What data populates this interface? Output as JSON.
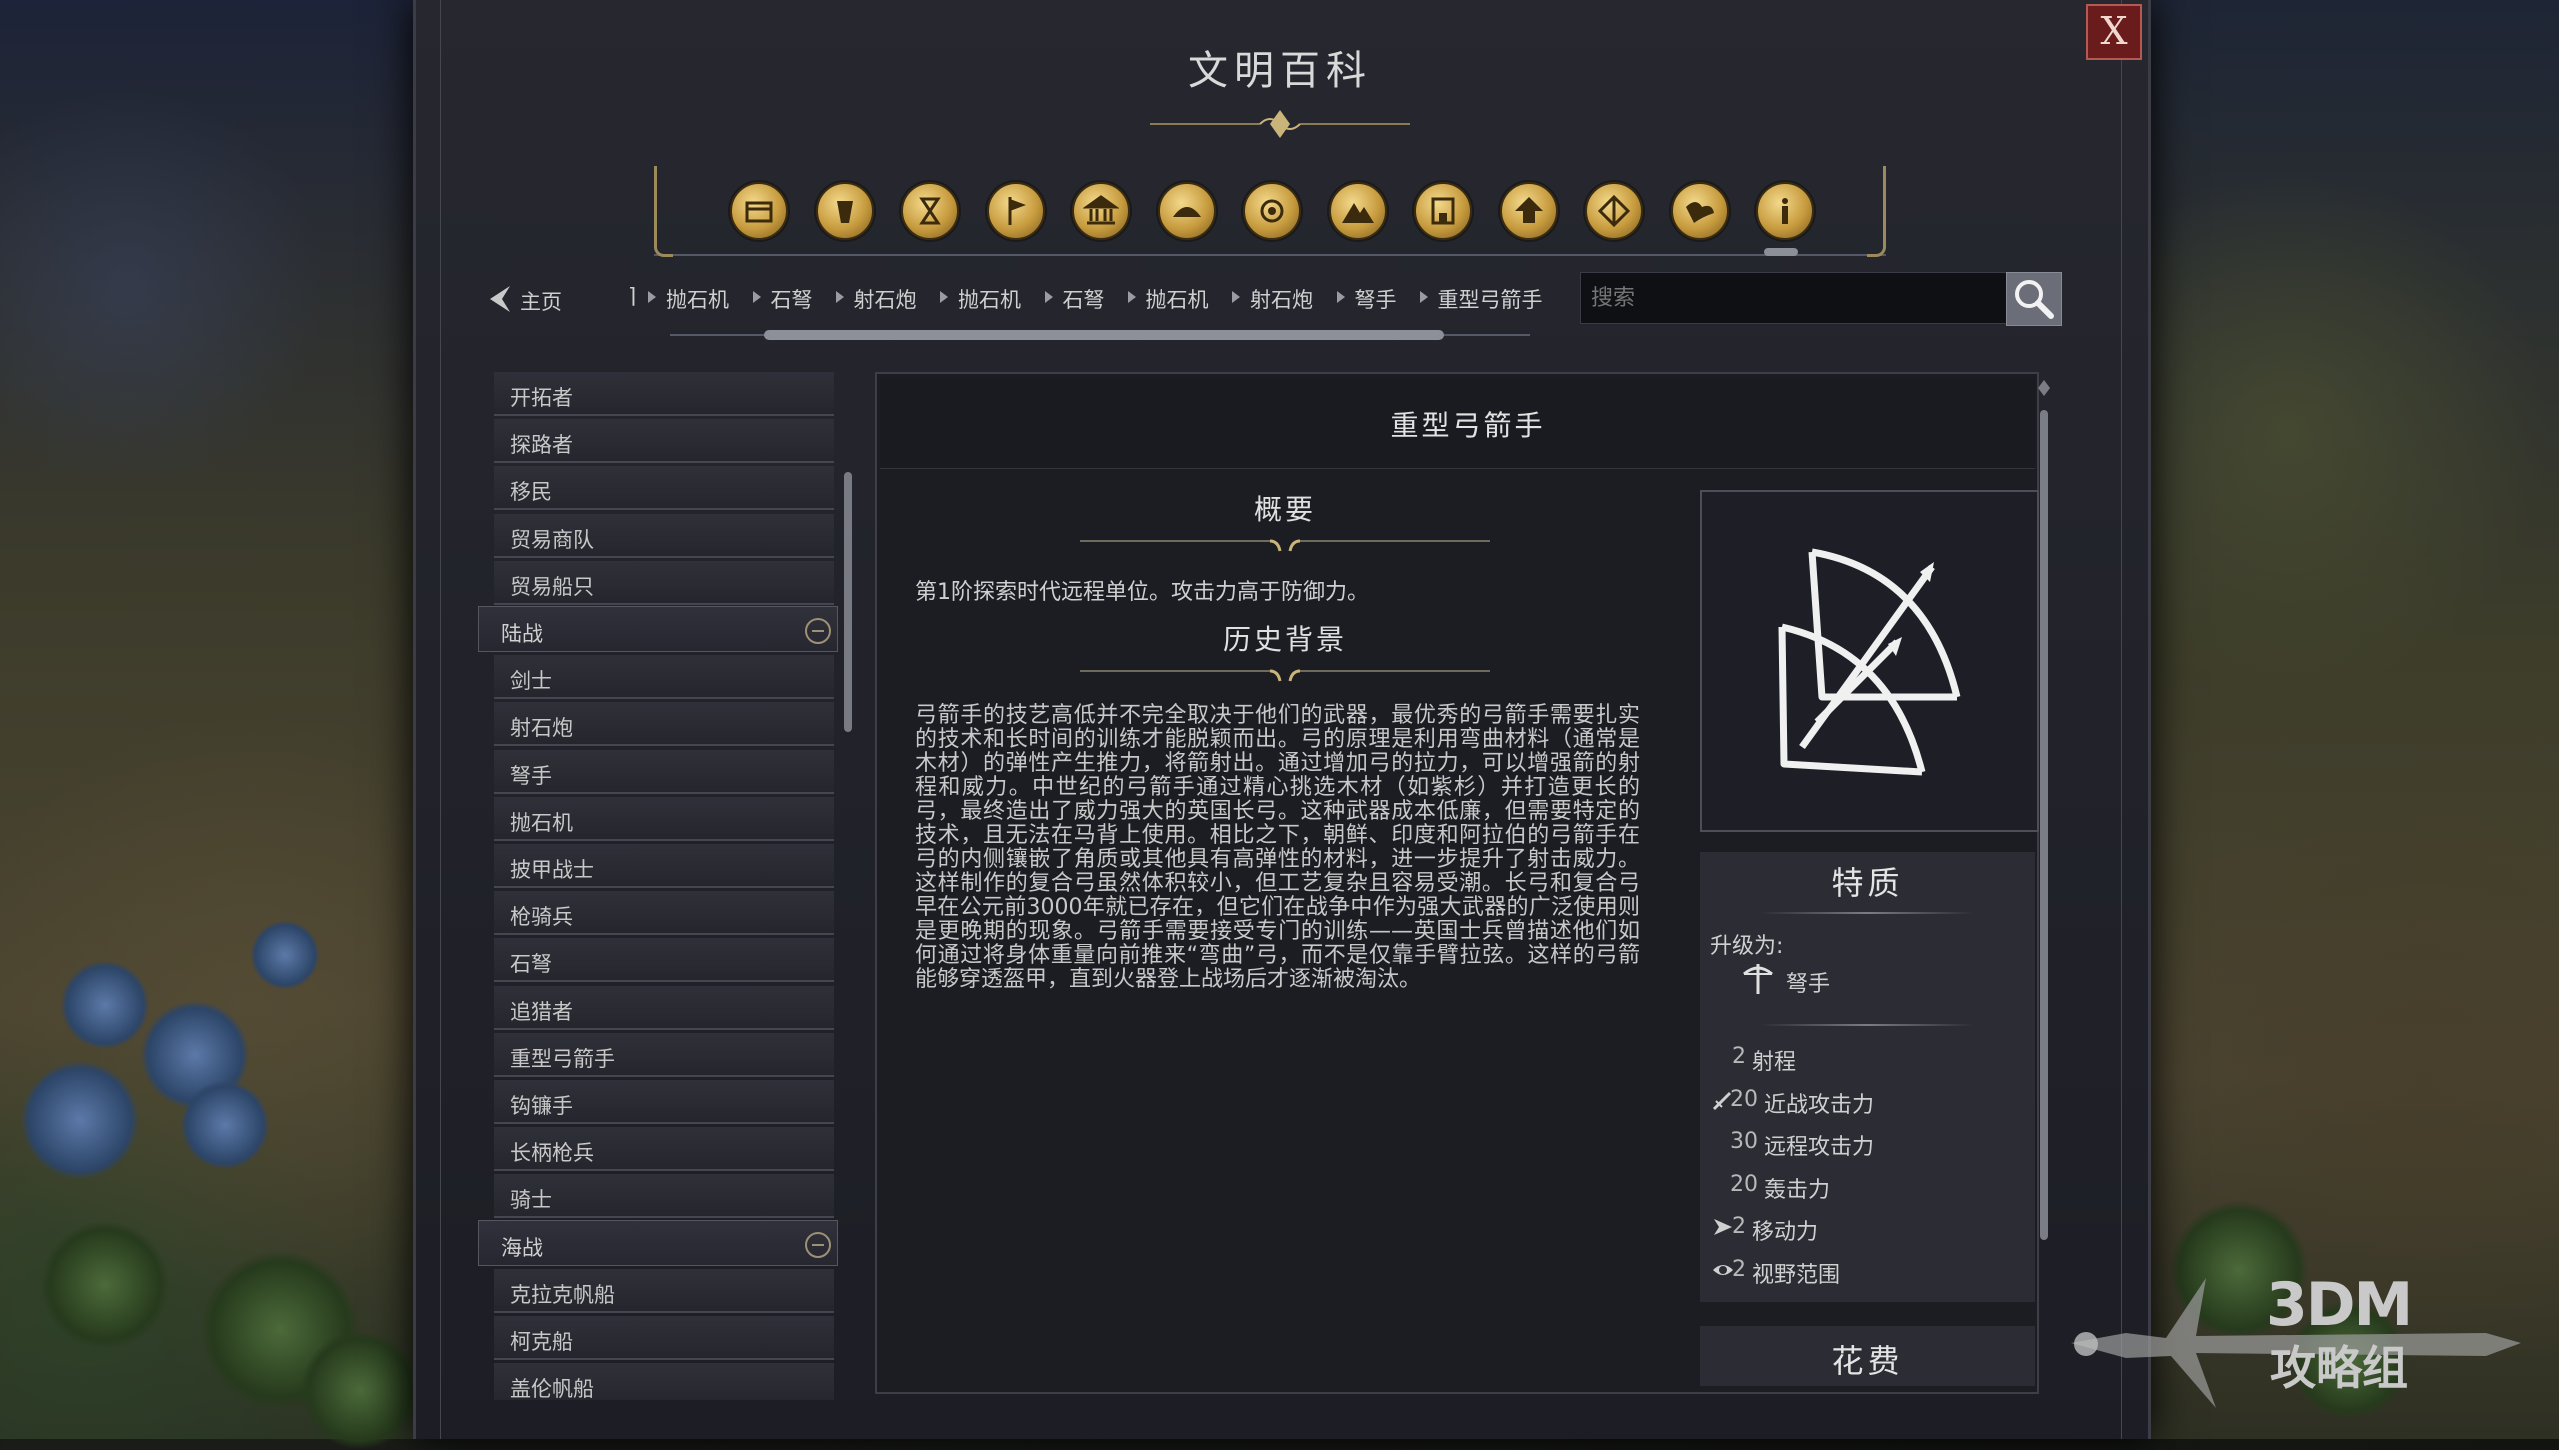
{
  "window": {
    "title": "文明百科",
    "close_label": "X"
  },
  "category_icons": [
    {
      "name": "units-icon"
    },
    {
      "name": "resources-icon"
    },
    {
      "name": "era-icon"
    },
    {
      "name": "civilization-flag-icon"
    },
    {
      "name": "buildings-icon"
    },
    {
      "name": "infrastructure-icon"
    },
    {
      "name": "wonders-icon"
    },
    {
      "name": "terrain-icon"
    },
    {
      "name": "districts-icon"
    },
    {
      "name": "upgrades-icon"
    },
    {
      "name": "technology-icon"
    },
    {
      "name": "religion-icon"
    },
    {
      "name": "info-icon"
    }
  ],
  "nav": {
    "home_label": "主页",
    "breadcrumbs": [
      "抛石机",
      "石弩",
      "射石炮",
      "抛石机",
      "石弩",
      "抛石机",
      "射石炮",
      "弩手",
      "重型弓箭手"
    ],
    "search_placeholder": "搜索"
  },
  "sidebar": {
    "items_top": [
      "开拓者",
      "探路者",
      "移民",
      "贸易商队",
      "贸易船只"
    ],
    "groups": [
      {
        "label": "陆战",
        "items": [
          "剑士",
          "射石炮",
          "弩手",
          "抛石机",
          "披甲战士",
          "枪骑兵",
          "石弩",
          "追猎者",
          "重型弓箭手",
          "钩镰手",
          "长柄枪兵",
          "骑士"
        ]
      },
      {
        "label": "海战",
        "items": [
          "克拉克帆船",
          "柯克船",
          "盖伦帆船"
        ]
      }
    ]
  },
  "detail": {
    "unit_name": "重型弓箭手",
    "summary_heading": "概要",
    "summary_text": "第1阶探索时代远程单位。攻击力高于防御力。",
    "history_heading": "历史背景",
    "history_text": "弓箭手的技艺高低并不完全取决于他们的武器，最优秀的弓箭手需要扎实的技术和长时间的训练才能脱颖而出。弓的原理是利用弯曲材料（通常是木材）的弹性产生推力，将箭射出。通过增加弓的拉力，可以增强箭的射程和威力。中世纪的弓箭手通过精心挑选木材（如紫杉）并打造更长的弓，最终造出了威力强大的英国长弓。这种武器成本低廉，但需要特定的技术，且无法在马背上使用。相比之下，朝鲜、印度和阿拉伯的弓箭手在弓的内侧镶嵌了角质或其他具有高弹性的材料，进一步提升了射击威力。这样制作的复合弓虽然体积较小，但工艺复杂且容易受潮。长弓和复合弓早在公元前3000年就已存在，但它们在战争中作为强大武器的广泛使用则是更晚期的现象。弓箭手需要接受专门的训练——英国士兵曾描述他们如何通过将身体重量向前推来“弯曲”弓，而不是仅靠手臂拉弦。这样的弓箭能够穿透盔甲，直到火器登上战场后才逐渐被淘汰。",
    "traits": {
      "heading": "特质",
      "upgrade_label": "升级为:",
      "upgrade_target": "弩手",
      "stats": [
        {
          "value": "2",
          "label": "射程",
          "icon": ""
        },
        {
          "value": "20",
          "label": "近战攻击力",
          "icon": "melee-attack-icon"
        },
        {
          "value": "30",
          "label": "远程攻击力",
          "icon": ""
        },
        {
          "value": "20",
          "label": "轰击力",
          "icon": ""
        },
        {
          "value": "2",
          "label": "移动力",
          "icon": "movement-icon"
        },
        {
          "value": "2",
          "label": "视野范围",
          "icon": "sight-icon"
        }
      ]
    },
    "cost_heading": "花费"
  },
  "watermark": {
    "line1": "3DM",
    "line2": "攻略组"
  }
}
